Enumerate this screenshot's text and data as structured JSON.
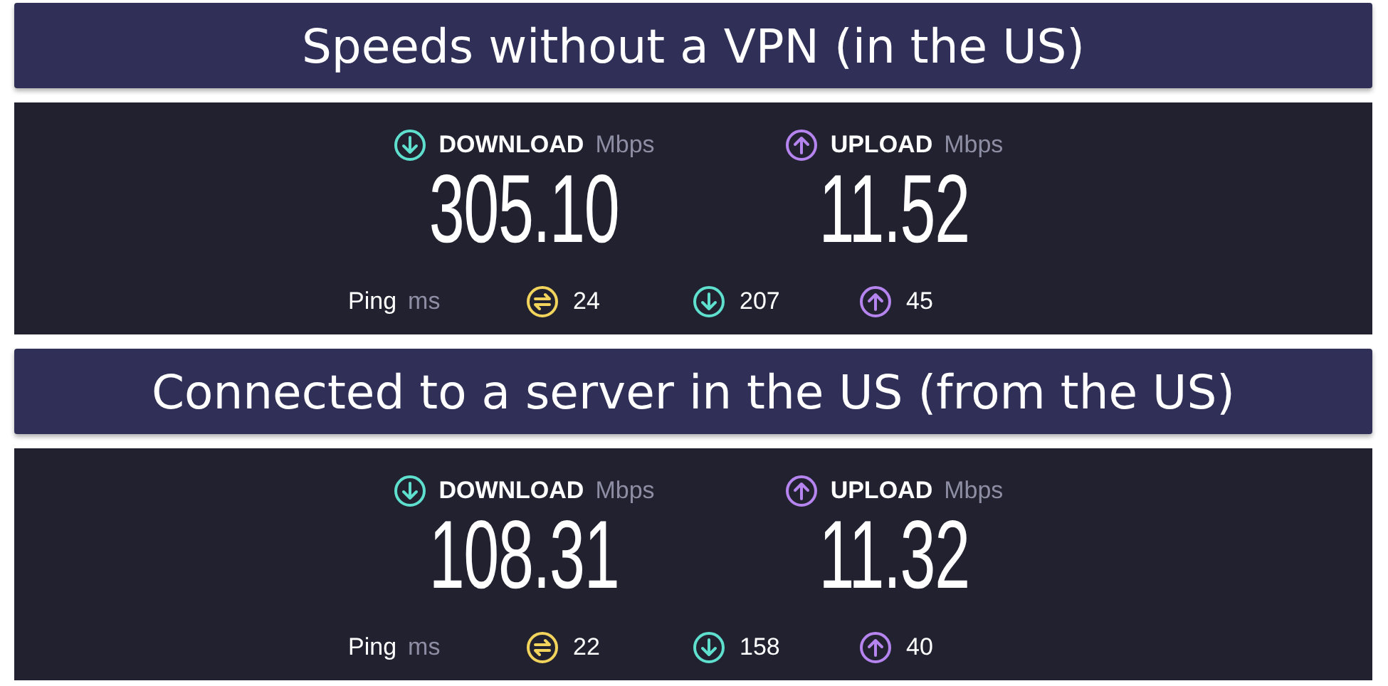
{
  "sections": [
    {
      "title": "Speeds without a VPN (in the US)",
      "download": {
        "label": "DOWNLOAD",
        "unit": "Mbps",
        "value": "305.10"
      },
      "upload": {
        "label": "UPLOAD",
        "unit": "Mbps",
        "value": "11.52"
      },
      "ping": {
        "label": "Ping",
        "unit": "ms",
        "items": [
          {
            "kind": "ping",
            "value": "24"
          },
          {
            "kind": "download",
            "value": "207"
          },
          {
            "kind": "upload",
            "value": "45"
          }
        ]
      }
    },
    {
      "title": "Connected to a server in the US (from the US)",
      "download": {
        "label": "DOWNLOAD",
        "unit": "Mbps",
        "value": "108.31"
      },
      "upload": {
        "label": "UPLOAD",
        "unit": "Mbps",
        "value": "11.32"
      },
      "ping": {
        "label": "Ping",
        "unit": "ms",
        "items": [
          {
            "kind": "ping",
            "value": "22"
          },
          {
            "kind": "download",
            "value": "158"
          },
          {
            "kind": "upload",
            "value": "40"
          }
        ]
      }
    }
  ]
}
